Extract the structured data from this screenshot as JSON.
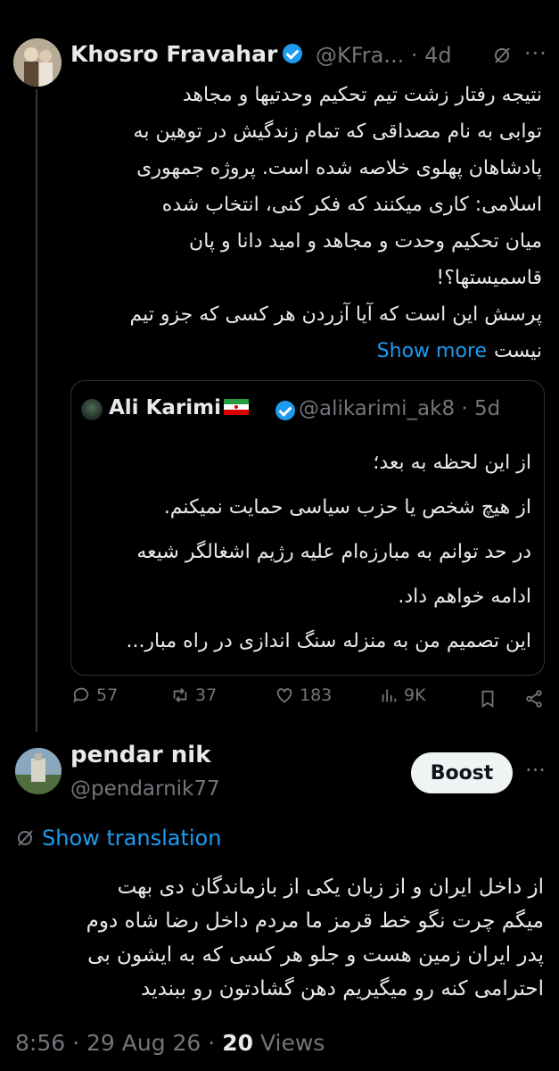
{
  "tweet": {
    "author_name": "Khosro Fravahar",
    "handle": "@KFra...",
    "time": "· 4d",
    "body_lines": [
      "نتیجه رفتار زشت تیم تحکیم وحدتیها و مجاهد",
      "توابی به نام مصداقی که تمام زندگیش در توهین به",
      "پادشاهان پهلوی خلاصه شده است. پروژه جمهوری",
      "اسلامی: کاری میکنند که فکر کنی، انتخاب شده",
      "میان تحکیم وحدت و مجاهد و امید دانا و پان",
      "قاسمیستها؟!",
      " پرسش این است که آیا آزردن هر کسی که جزو تیم"
    ],
    "last_line": "نیست",
    "show_more": "Show more",
    "quote": {
      "author_name": "Ali Karimi",
      "handle": "@alikarimi_ak8 · 5d",
      "lines": [
        "از این لحظه به بعد؛",
        "از هیچ شخص یا حزب سیاسی حمایت نمیکنم.",
        "در حد توانم به مبارزه‌ام علیه رژیم اشغالگر شیعه",
        "ادامه خواهم داد.",
        "این تصمیم من به منزله سنگ اندازی در راه مبار..."
      ]
    },
    "actions": {
      "replies": "57",
      "reposts": "37",
      "likes": "183",
      "views": "9K"
    }
  },
  "reply": {
    "author_name": "pendar nik",
    "handle": "@pendarnik77",
    "boost_label": "Boost",
    "show_translation": "Show translation",
    "body_lines": [
      "از داخل ایران و از زبان یکی از بازماندگان دی بهت",
      "میگم چرت نگو خط قرمز ما مردم داخل رضا شاه دوم",
      "پدر ایران زمین هست و جلو هر کسی که به ایشون بی",
      "احترامی کنه رو میگیریم  دهن گشادتون رو ببندید"
    ],
    "time": "8:56",
    "date": "29 Aug 26",
    "views_count": "20",
    "views_label": "Views"
  },
  "colors": {
    "background": "#000000",
    "text": "#e7e9ea",
    "muted": "#71767b",
    "accent": "#1d9bf0",
    "border": "#2f3336"
  },
  "icons": [
    "verified-badge-icon",
    "grok-icon",
    "more-icon",
    "reply-icon",
    "repost-icon",
    "like-icon",
    "views-icon",
    "bookmark-icon",
    "share-icon",
    "translate-icon",
    "iran-flag-icon"
  ]
}
